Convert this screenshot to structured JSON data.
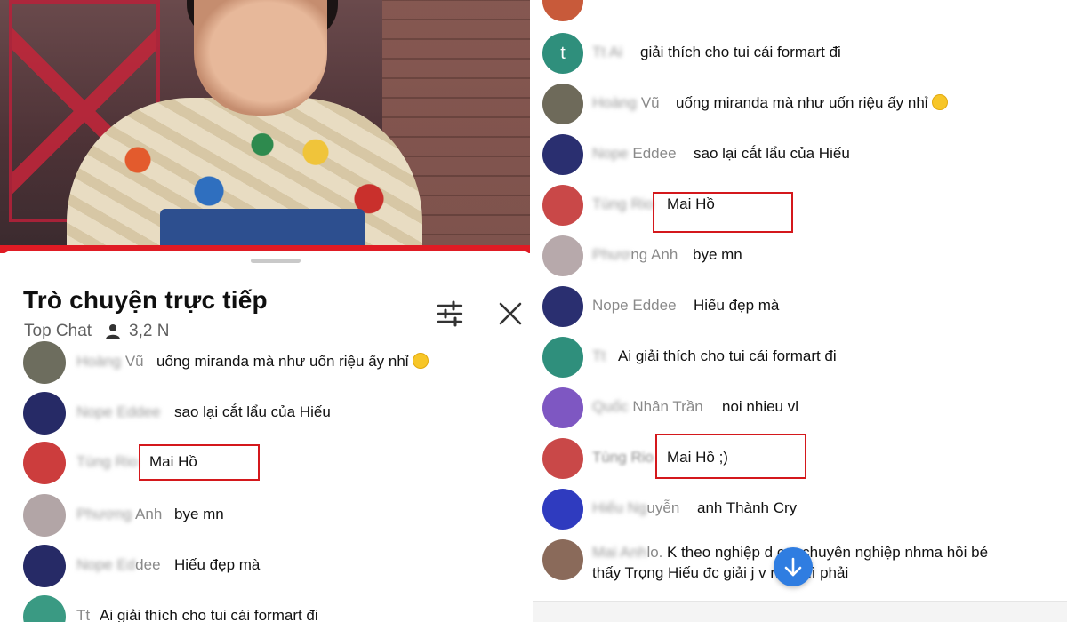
{
  "left": {
    "chat_title": "Trò chuyện trực tiếp",
    "filter": "Top Chat",
    "viewer_count": "3,2 N",
    "messages": [
      {
        "author": "Hoàng Vũ",
        "author_visible": "Vũ",
        "text": "uống miranda mà như uốn riệu ấy nhỉ",
        "emoji": "slightly-smiling-face-icon",
        "avatar_color": "#7a7a6a"
      },
      {
        "author": "Nope Eddee",
        "author_visible": "",
        "text": "sao lại cắt lẩu của Hiếu",
        "avatar_color": "#2b2f6e"
      },
      {
        "author": "Tùng Rio",
        "author_visible": "",
        "text": "Mai Hồ",
        "avatar_color": "#d04040"
      },
      {
        "author": "Phương Anh",
        "author_visible": "Anh",
        "text": "bye mn",
        "avatar_color": "#b7a8a8"
      },
      {
        "author": "Nope Eddee",
        "author_visible": "dee",
        "text": "Hiếu đẹp mà",
        "avatar_color": "#2b2f6e"
      },
      {
        "author": "Tt",
        "author_visible": "Tt",
        "text": "Ai giải thích cho tui cái formart đi",
        "avatar_color": "#3a9a83"
      }
    ]
  },
  "right": {
    "messages": [
      {
        "author": "Tt",
        "author_visible": "",
        "text": "giải thích cho tui cái formart đi",
        "avatar_color": "#2f8f7c",
        "avatar_letter": "t"
      },
      {
        "author": "Hoàng Vũ",
        "author_visible": "Vũ",
        "text": "uống miranda mà như uốn riệu ấy nhỉ",
        "emoji": "slightly-smiling-face-icon",
        "avatar_color": "#6e6a5a"
      },
      {
        "author": "Nope Eddee",
        "author_visible": "Eddee",
        "text": "sao lại cắt lẩu của Hiếu",
        "avatar_color": "#2a2f70"
      },
      {
        "author": "Tùng Rio",
        "author_visible": "",
        "text": "Mai Hồ",
        "avatar_color": "#c94848"
      },
      {
        "author": "Phương Anh",
        "author_visible": "ng Anh",
        "text": "bye mn",
        "avatar_color": "#b7a9ab"
      },
      {
        "author": "Nope Eddee",
        "author_visible": "Nope Eddee",
        "text": "Hiếu đẹp mà",
        "avatar_color": "#2a2f70"
      },
      {
        "author": "Tt",
        "author_visible": "",
        "text": "Ai giải thích cho tui cái formart đi",
        "avatar_color": "#2f8f7c"
      },
      {
        "author": "Quốc Nhân Trần",
        "author_visible": "Nhân Trần",
        "text": "noi nhieu vl",
        "avatar_color": "#7e57c2"
      },
      {
        "author": "Tùng Rio",
        "author_visible": "Tùng Rio",
        "text": "Mai Hồ ;)",
        "avatar_color": "#c94848"
      },
      {
        "author": "Hiếu Nguyễn",
        "author_visible": "uyễn",
        "text": "anh Thành Cry",
        "avatar_color": "#2f3bbf"
      },
      {
        "author": "Mai Anh",
        "author_visible": "lo.",
        "text": "K theo nghiệp d   cer chuyên nghiệp nhma hồi bé",
        "text_line2": "thấy Trọng Hiếu đc giải j v   nce thì phải",
        "avatar_color": "#8a6a5a"
      }
    ]
  },
  "colors": {
    "highlight_box": "#d4181c",
    "scroll_button": "#2f7de1",
    "video_red_bar": "#e01b24"
  }
}
